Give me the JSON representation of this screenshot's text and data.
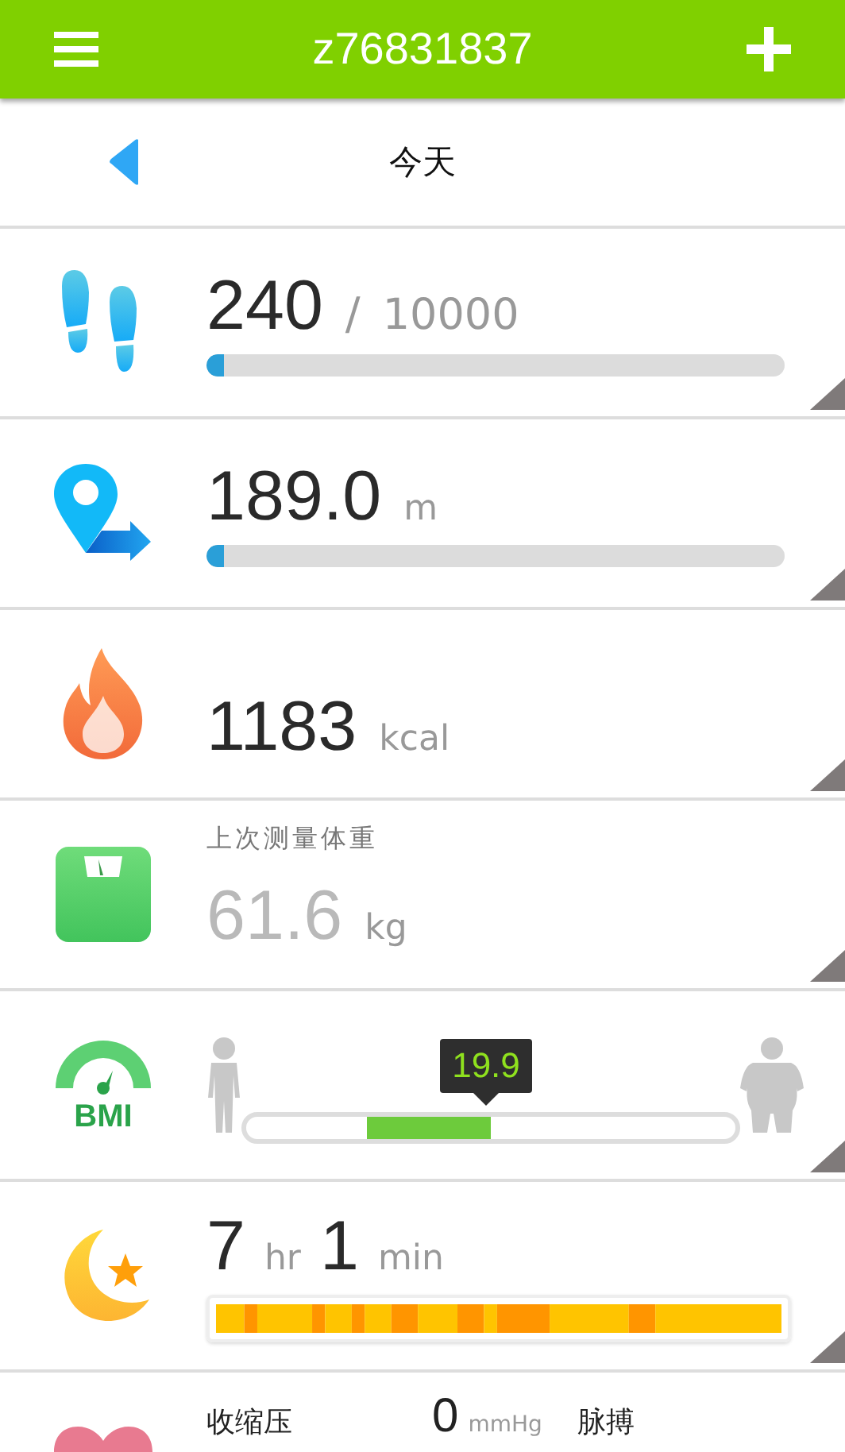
{
  "header": {
    "title": "z76831837"
  },
  "date_bar": {
    "label": "今天"
  },
  "cards": [
    {
      "kind": "steps",
      "value": "240",
      "separator": "/",
      "target": "10000",
      "level": 0.024
    },
    {
      "kind": "distance",
      "value": "189.0",
      "unit": "m",
      "level": 0.02
    },
    {
      "kind": "calories",
      "value": "1183",
      "unit": "kcal"
    },
    {
      "kind": "weight",
      "caption": "上次测量体重",
      "value": "61.6",
      "unit": "kg"
    },
    {
      "kind": "bmi",
      "icon_label": "BMI",
      "value": "19.9"
    },
    {
      "kind": "sleep",
      "hours": "7",
      "hours_unit": "hr",
      "minutes": "1",
      "minutes_unit": "min"
    },
    {
      "kind": "blood_pressure",
      "label": "收缩压",
      "value": "0",
      "unit": "mmHg",
      "pulse_label": "脉搏"
    }
  ]
}
